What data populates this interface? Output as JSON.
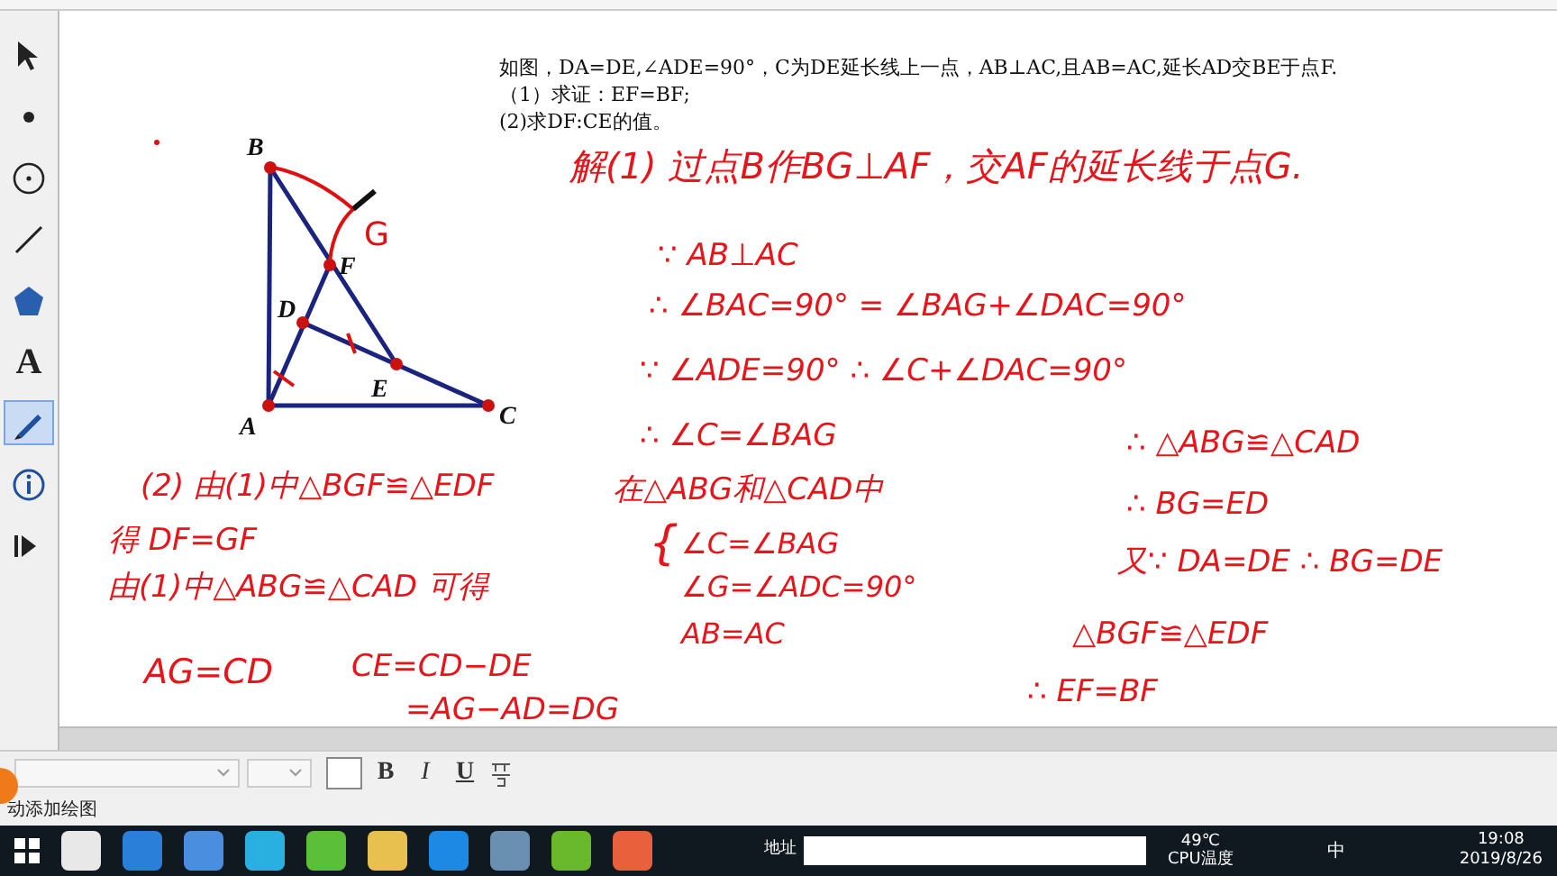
{
  "toolbox": {
    "tools": [
      {
        "kind": "arrow",
        "selected": false
      },
      {
        "kind": "point",
        "selected": false
      },
      {
        "kind": "compass",
        "selected": false
      },
      {
        "kind": "line",
        "selected": false
      },
      {
        "kind": "polygon",
        "selected": false
      },
      {
        "kind": "text",
        "label": "A",
        "selected": false
      },
      {
        "kind": "marker",
        "selected": true
      },
      {
        "kind": "info",
        "selected": false
      },
      {
        "kind": "custom",
        "selected": false
      }
    ]
  },
  "problem": {
    "lines": [
      "如图，DA=DE,∠ADE=90°，C为DE延长线上一点，AB⊥AC,且AB=AC,延长AD交BE于点F.",
      "（1）求证：EF=BF;",
      "(2)求DF:CE的值。"
    ]
  },
  "diagram": {
    "points": [
      {
        "label": "B"
      },
      {
        "label": "F"
      },
      {
        "label": "D"
      },
      {
        "label": "E"
      },
      {
        "label": "A"
      },
      {
        "label": "C"
      }
    ],
    "handwritten_label": "G"
  },
  "notes": [
    {
      "text": "解(1) 过点B作BG⊥AF，交AF的延长线于点G."
    },
    {
      "text": "∵ AB⊥AC"
    },
    {
      "text": "∴ ∠BAC=90° = ∠BAG+∠DAC=90°"
    },
    {
      "text": "∵ ∠ADE=90° ∴ ∠C+∠DAC=90°"
    },
    {
      "text": "∴ ∠C=∠BAG"
    },
    {
      "text": "在△ABG和△CAD中"
    },
    {
      "text": "{"
    },
    {
      "text": "∠C=∠BAG"
    },
    {
      "text": "∠G=∠ADC=90°"
    },
    {
      "text": "AB=AC"
    },
    {
      "text": "∴ △ABG≌△CAD"
    },
    {
      "text": "∴ BG=ED"
    },
    {
      "text": "又∵ DA=DE ∴ BG=DE"
    },
    {
      "text": "△BGF≌△EDF"
    },
    {
      "text": "∴ EF=BF"
    },
    {
      "text": "(2) 由(1)中△BGF≌△EDF"
    },
    {
      "text": "得 DF=GF"
    },
    {
      "text": "由(1)中△ABG≌△CAD 可得"
    },
    {
      "text": "AG=CD"
    },
    {
      "text": "CE=CD−DE"
    },
    {
      "text": "=AG−AD=DG"
    }
  ],
  "text_toolbar": {
    "buttons": [
      {
        "kind": "bold",
        "label": "B"
      },
      {
        "kind": "italic",
        "label": "I"
      },
      {
        "kind": "underline",
        "label": "U"
      }
    ]
  },
  "status_bar": {
    "text": "动添加绘图"
  },
  "taskbar": {
    "address_label": "地址",
    "temperature": "49℃",
    "temperature_label": "CPU温度",
    "ime": "中",
    "time": "19:08",
    "date": "2019/8/26"
  }
}
